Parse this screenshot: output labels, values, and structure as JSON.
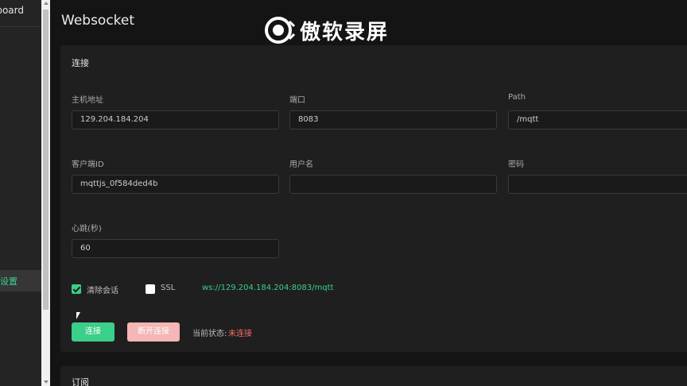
{
  "sidebar": {
    "brand_text": "Dashboard",
    "active_item_text": "设置"
  },
  "page": {
    "title": "Websocket"
  },
  "watermark": {
    "text": "傲软录屏"
  },
  "connect": {
    "card_title": "连接",
    "host": {
      "label": "主机地址",
      "value": "129.204.184.204"
    },
    "port": {
      "label": "端口",
      "value": "8083"
    },
    "path": {
      "label": "Path",
      "value": "/mqtt"
    },
    "client_id": {
      "label": "客户端ID",
      "value": "mqttjs_0f584ded4b"
    },
    "username": {
      "label": "用户名",
      "value": ""
    },
    "password": {
      "label": "密码",
      "value": ""
    },
    "keepalive": {
      "label": "心跳(秒)",
      "value": "60"
    },
    "clean_session": {
      "label": "清除会话",
      "checked": true
    },
    "ssl": {
      "label": "SSL",
      "checked": false
    },
    "ws_url": "ws://129.204.184.204:8083/mqtt",
    "connect_button": "连接",
    "disconnect_button": "断开连接",
    "state_label": "当前状态:",
    "state_value": "未连接"
  },
  "subscribe": {
    "card_title": "订阅"
  },
  "colors": {
    "accent": "#3ccf89",
    "danger": "#f56c6c",
    "disconnect_bg": "#f4b6b6"
  }
}
